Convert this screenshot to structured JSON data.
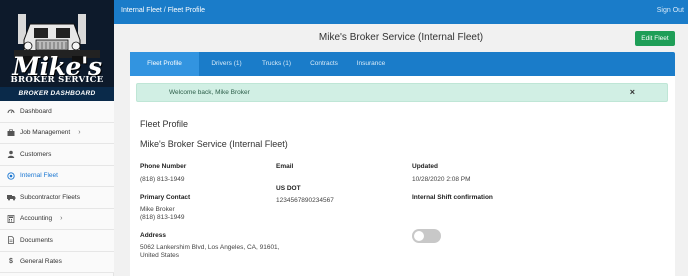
{
  "brand": {
    "logo_line1": "Mike's",
    "logo_line2": "BROKER SERVICE",
    "dashboard_label": "BROKER DASHBOARD"
  },
  "sidebar": {
    "items": [
      {
        "label": "Dashboard",
        "icon": "speedometer-icon"
      },
      {
        "label": "Job Management",
        "icon": "briefcase-icon",
        "chevron": "›"
      },
      {
        "label": "Customers",
        "icon": "person-icon"
      },
      {
        "label": "Internal Fleet",
        "icon": "target-icon",
        "active": true
      },
      {
        "label": "Subcontractor Fleets",
        "icon": "truck-icon"
      },
      {
        "label": "Accounting",
        "icon": "calculator-icon",
        "chevron": "›"
      },
      {
        "label": "Documents",
        "icon": "document-icon"
      },
      {
        "label": "General Rates",
        "icon": "dollar-icon"
      }
    ]
  },
  "topbar": {
    "breadcrumb": "Internal Fleet / Fleet Profile",
    "signout_label": "Sign Out"
  },
  "header": {
    "title": "Mike's Broker Service (Internal Fleet)",
    "edit_button": "Edit Fleet"
  },
  "tabs": [
    {
      "label": "Fleet Profile",
      "active": true
    },
    {
      "label": "Drivers (1)"
    },
    {
      "label": "Trucks (1)"
    },
    {
      "label": "Contracts"
    },
    {
      "label": "Insurance"
    }
  ],
  "alert": {
    "message": "Welcome back, Mike Broker",
    "close_glyph": "×"
  },
  "profile": {
    "section_title": "Fleet Profile",
    "fleet_name": "Mike's Broker Service (Internal Fleet)",
    "phone_label": "Phone Number",
    "phone_value": "(818) 813-1949",
    "email_label": "Email",
    "email_value": "",
    "updated_label": "Updated",
    "updated_value": "10/28/2020 2:08 PM",
    "contact_label": "Primary Contact",
    "contact_name": "Mike Broker",
    "contact_phone": "(818) 813-1949",
    "usdot_label": "US DOT",
    "usdot_value": "1234567890234567",
    "shift_label": "Internal Shift confirmation",
    "shift_enabled": false,
    "address_label": "Address",
    "address_line1": "5062 Lankershim Blvd, Los Angeles, CA, 91601,",
    "address_line2": "United States"
  },
  "colors": {
    "primary": "#1a7cc9",
    "tab_active": "#3294e0",
    "success": "#1e9e57",
    "alert_bg": "#d1efe4",
    "sidebar_dark": "#0d1a2b"
  }
}
